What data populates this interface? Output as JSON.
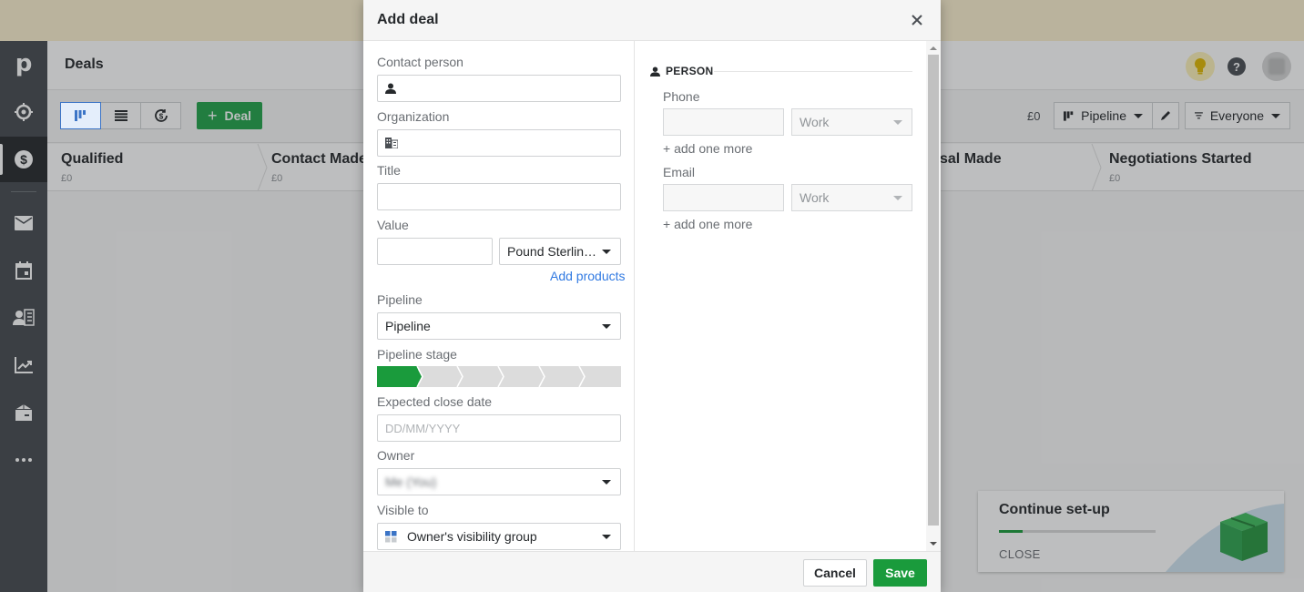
{
  "app": {
    "page_title": "Deals",
    "logo": "p"
  },
  "sidebar": {
    "items": [
      {
        "name": "logo",
        "icon": "pipedrive-logo"
      },
      {
        "name": "leads",
        "icon": "target-icon"
      },
      {
        "name": "deals",
        "icon": "dollar-icon",
        "active": true
      },
      {
        "name": "mail",
        "icon": "mail-icon"
      },
      {
        "name": "activities",
        "icon": "calendar-icon"
      },
      {
        "name": "contacts",
        "icon": "contacts-icon"
      },
      {
        "name": "insights",
        "icon": "chart-icon"
      },
      {
        "name": "products",
        "icon": "box-icon"
      },
      {
        "name": "more",
        "icon": "more-icon"
      }
    ]
  },
  "toolbar": {
    "views": [
      "pipeline-view",
      "list-view",
      "forecast-view"
    ],
    "active_view": "pipeline-view",
    "add_deal_label": "Deal",
    "total": "£0",
    "pipeline_label": "Pipeline",
    "filter_label": "Everyone"
  },
  "stages": [
    {
      "name": "Qualified",
      "value": "£0"
    },
    {
      "name": "Contact Made",
      "value": "£0"
    },
    {
      "name": "sal Made",
      "value": ""
    },
    {
      "name": "Negotiations Started",
      "value": "£0"
    }
  ],
  "setup_card": {
    "title": "Continue set-up",
    "progress": 0.15,
    "close_label": "CLOSE"
  },
  "modal": {
    "title": "Add deal",
    "fields": {
      "contact_person": {
        "label": "Contact person",
        "value": ""
      },
      "organization": {
        "label": "Organization",
        "value": ""
      },
      "title": {
        "label": "Title",
        "value": ""
      },
      "value": {
        "label": "Value",
        "amount": "",
        "currency": "Pound Sterlin…"
      },
      "add_products": "Add products",
      "pipeline": {
        "label": "Pipeline",
        "value": "Pipeline"
      },
      "pipeline_stage": {
        "label": "Pipeline stage",
        "stage_count": 6,
        "selected_index": 0
      },
      "expected_close_date": {
        "label": "Expected close date",
        "placeholder": "DD/MM/YYYY"
      },
      "owner": {
        "label": "Owner",
        "value": "Me (You)"
      },
      "visible_to": {
        "label": "Visible to",
        "value": "Owner's visibility group"
      }
    },
    "person_section": {
      "heading": "PERSON",
      "phone": {
        "label": "Phone",
        "value": "",
        "type": "Work"
      },
      "email": {
        "label": "Email",
        "value": "",
        "type": "Work"
      },
      "add_more": "+ add one more"
    },
    "footer": {
      "cancel": "Cancel",
      "save": "Save"
    }
  },
  "colors": {
    "brand_green": "#1a9b3c",
    "link_blue": "#317ae2",
    "sidebar_bg": "#464a4f"
  }
}
